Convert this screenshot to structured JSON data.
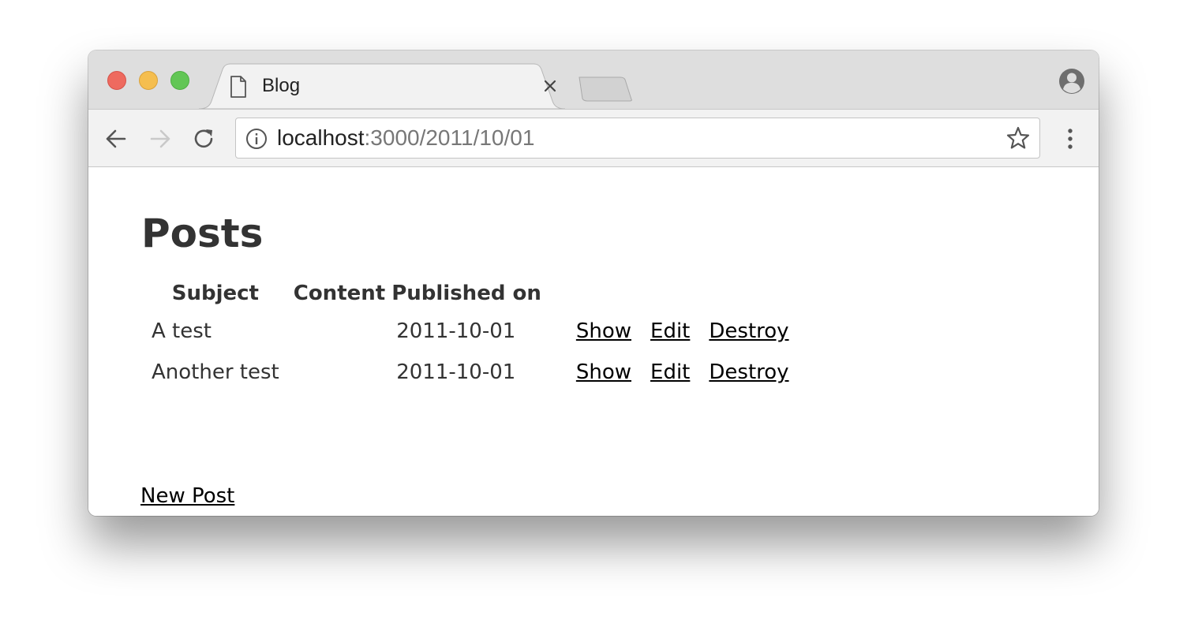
{
  "browser": {
    "tab_title": "Blog",
    "url_host": "localhost",
    "url_rest": ":3000/2011/10/01"
  },
  "icons": {
    "tab": "document-icon",
    "close": "close-icon",
    "profile": "profile-icon",
    "back": "back-arrow-icon",
    "forward": "forward-arrow-icon",
    "reload": "reload-icon",
    "info": "info-icon",
    "star": "star-icon",
    "menu": "kebab-menu-icon"
  },
  "colors": {
    "close": "#ee6a5f",
    "minimize": "#f5be4f",
    "maximize": "#62c655",
    "heading_text": "#333333",
    "link_text": "#000000"
  },
  "page": {
    "title": "Posts",
    "table": {
      "headers": [
        "Subject",
        "Content",
        "Published on"
      ],
      "rows": [
        {
          "subject": "A test",
          "content": "",
          "published_on": "2011-10-01",
          "actions": [
            "Show",
            "Edit",
            "Destroy"
          ]
        },
        {
          "subject": "Another test",
          "content": "",
          "published_on": "2011-10-01",
          "actions": [
            "Show",
            "Edit",
            "Destroy"
          ]
        }
      ]
    },
    "new_post_link": "New Post"
  }
}
